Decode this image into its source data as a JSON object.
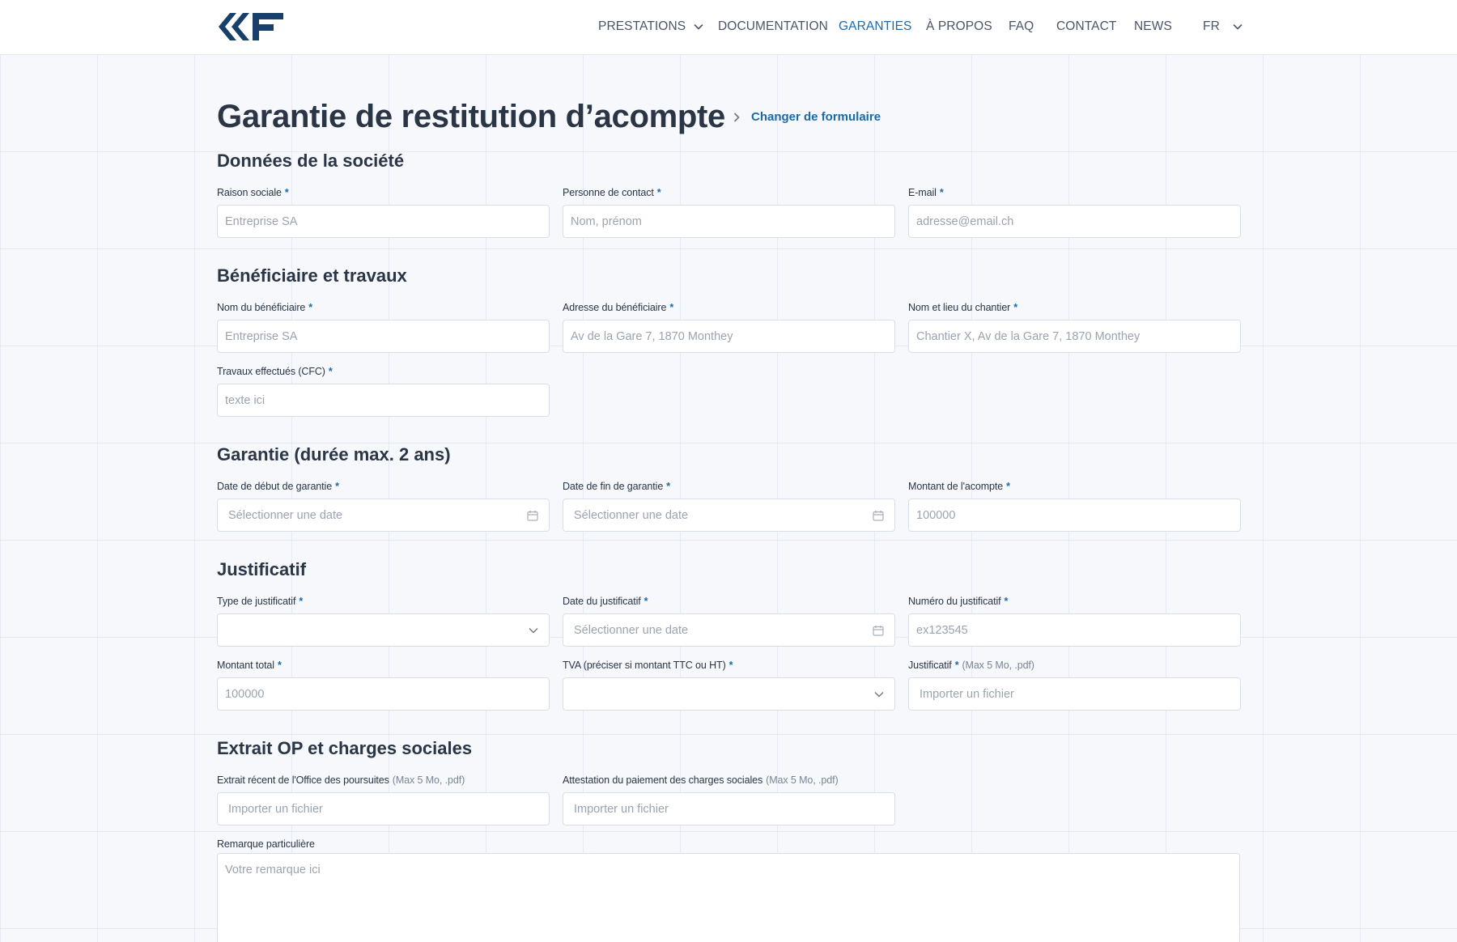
{
  "header": {
    "logo_icon": "ccf-logo-icon",
    "nav": [
      {
        "label": "PRESTATIONS",
        "has_dropdown": true
      },
      {
        "label": "DOCUMENTATION"
      },
      {
        "label": "GARANTIES",
        "active": true
      },
      {
        "label": "À PROPOS"
      },
      {
        "label": "FAQ"
      },
      {
        "label": "CONTACT"
      },
      {
        "label": "NEWS"
      },
      {
        "label": "FR",
        "has_dropdown": true
      }
    ]
  },
  "page": {
    "title": "Garantie de restitution d’acompte",
    "change_form_label": "Changer de formulaire"
  },
  "colors": {
    "accent": "#1c6aa8",
    "heading": "#2a3546",
    "background": "#f6f8fb"
  },
  "sections": {
    "company": {
      "title": "Données de la société",
      "fields": {
        "raison_sociale": {
          "label": "Raison sociale",
          "required": "*",
          "placeholder": "Entreprise SA"
        },
        "contact": {
          "label": "Personne de contact",
          "required": "*",
          "placeholder": "Nom, prénom"
        },
        "email": {
          "label": "E-mail",
          "required": "*",
          "placeholder": "adresse@email.ch"
        }
      }
    },
    "beneficiary": {
      "title": "Bénéficiaire et travaux",
      "fields": {
        "nom": {
          "label": "Nom du bénéficiaire",
          "required": "*",
          "placeholder": "Entreprise SA"
        },
        "adresse": {
          "label": "Adresse du bénéficiaire",
          "required": "*",
          "placeholder": "Av de la Gare 7, 1870 Monthey"
        },
        "chantier": {
          "label": "Nom et lieu du chantier",
          "required": "*",
          "placeholder": "Chantier X, Av de la Gare 7, 1870 Monthey"
        },
        "travaux": {
          "label": "Travaux effectués (CFC)",
          "required": "*",
          "placeholder": "texte ici"
        }
      }
    },
    "guarantee": {
      "title": "Garantie (durée max. 2 ans)",
      "fields": {
        "debut": {
          "label": "Date de début de garantie",
          "required": "*",
          "placeholder": "Sélectionner une date",
          "icon": "calendar-icon"
        },
        "fin": {
          "label": "Date de fin de garantie",
          "required": "*",
          "placeholder": "Sélectionner une date",
          "icon": "calendar-icon"
        },
        "montant": {
          "label": "Montant de l'acompte",
          "required": "*",
          "placeholder": "100000"
        }
      }
    },
    "justificatif": {
      "title": "Justificatif",
      "fields": {
        "type": {
          "label": "Type de justificatif",
          "required": "*",
          "value": "",
          "icon": "chevron-down-icon"
        },
        "date": {
          "label": "Date du justificatif",
          "required": "*",
          "placeholder": "Sélectionner une date",
          "icon": "calendar-icon"
        },
        "numero": {
          "label": "Numéro du justificatif",
          "required": "*",
          "placeholder": "ex123545"
        },
        "total": {
          "label": "Montant total",
          "required": "*",
          "placeholder": "100000"
        },
        "tva": {
          "label": "TVA (préciser si montant TTC ou HT)",
          "required": "*",
          "value": "",
          "icon": "chevron-down-icon"
        },
        "fichier": {
          "label": "Justificatif",
          "required": "*",
          "hint": "(Max 5 Mo, .pdf)",
          "placeholder": "Importer un fichier"
        }
      }
    },
    "extrait": {
      "title": "Extrait OP et charges sociales",
      "fields": {
        "office": {
          "label": "Extrait récent de l'Office des poursuites",
          "hint": "(Max 5 Mo, .pdf)",
          "placeholder": "Importer un fichier"
        },
        "charges": {
          "label": "Attestation du paiement des charges sociales",
          "hint": "(Max 5 Mo, .pdf)",
          "placeholder": "Importer un fichier"
        },
        "remarque": {
          "label": "Remarque particulière",
          "placeholder": "Votre remarque ici"
        }
      }
    }
  }
}
